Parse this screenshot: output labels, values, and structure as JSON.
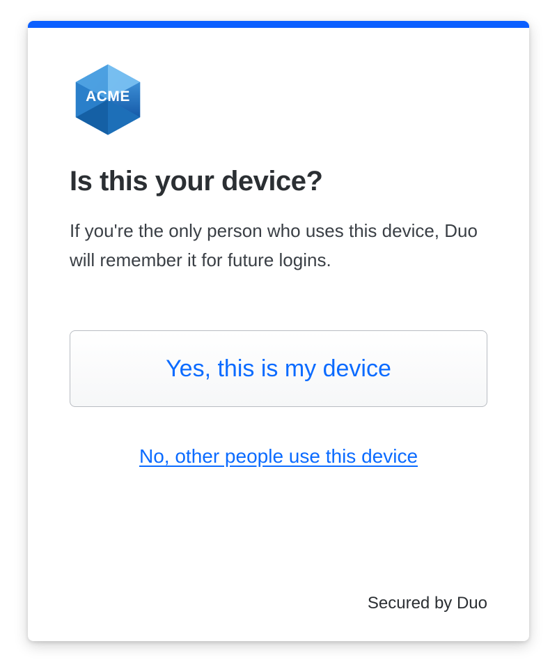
{
  "logo": {
    "text": "ACME"
  },
  "heading": "Is this your device?",
  "description": "If you're the only person who uses this device, Duo will remember it for future logins.",
  "buttons": {
    "confirm": "Yes, this is my device",
    "deny": "No, other people use this device"
  },
  "footer": "Secured by Duo",
  "colors": {
    "accent": "#0b5fff",
    "link": "#0b6bff",
    "text": "#2b2f33"
  }
}
